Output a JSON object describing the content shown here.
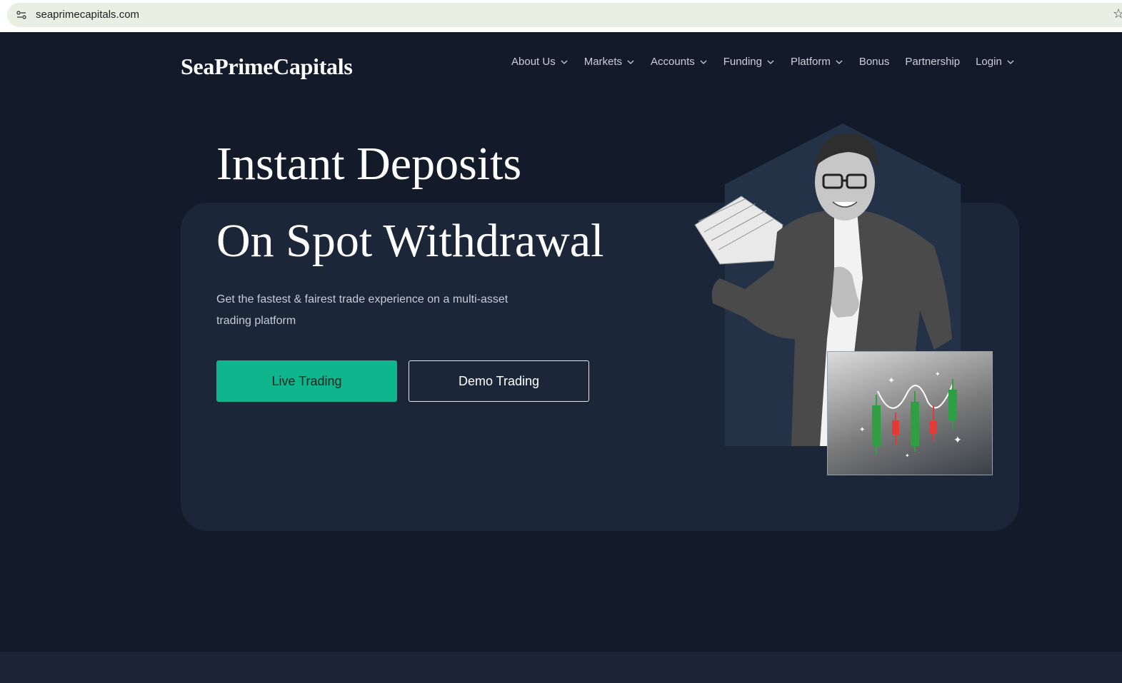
{
  "browser": {
    "url": "seaprimecapitals.com"
  },
  "header": {
    "logo": "SeaPrimeCapitals",
    "nav": [
      {
        "label": "About Us",
        "dropdown": true
      },
      {
        "label": "Markets",
        "dropdown": true
      },
      {
        "label": "Accounts",
        "dropdown": true
      },
      {
        "label": "Funding",
        "dropdown": true
      },
      {
        "label": "Platform",
        "dropdown": true
      },
      {
        "label": "Bonus",
        "dropdown": false
      },
      {
        "label": "Partnership",
        "dropdown": false
      },
      {
        "label": "Login",
        "dropdown": true
      }
    ]
  },
  "hero": {
    "title_line1": "Instant Deposits",
    "title_line2": "On Spot Withdrawal",
    "subtitle": "Get the fastest & fairest trade experience on a multi-asset trading platform",
    "live_button": "Live Trading",
    "demo_button": "Demo Trading"
  },
  "colors": {
    "background": "#131b2b",
    "card": "#1b2639",
    "accent": "#0fb58c"
  },
  "icons": {
    "site_info": "tune-icon",
    "bookmark": "star-icon",
    "dropdown": "chevron-down-icon"
  }
}
